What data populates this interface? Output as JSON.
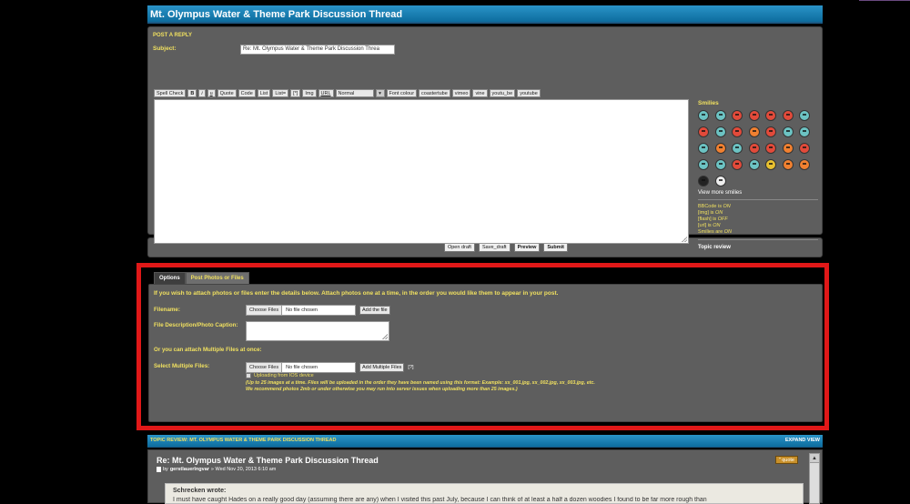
{
  "thread_title": "Mt. Olympus Water & Theme Park Discussion Thread",
  "post_reply": {
    "heading": "POST A REPLY",
    "subject_label": "Subject:",
    "subject_value": "Re: Mt. Olympus Water & Theme Park Discussion Threa"
  },
  "toolbar": {
    "spell_check": "Spell Check",
    "bold": "B",
    "italic": "i",
    "underline": "u",
    "quote": "Quote",
    "code": "Code",
    "list": "List",
    "list_eq": "List=",
    "list_item": "[*]",
    "img": "Img",
    "url": "URL",
    "font_size": "Normal",
    "font_colour": "Font colour",
    "coastertube": "coastertube",
    "vimeo": "vimeo",
    "vine": "vine",
    "youtu_be": "youtu_be",
    "youtube": "youtube"
  },
  "smilies": {
    "title": "Smilies",
    "view_more": "View more smilies",
    "icons": [
      "teal",
      "teal",
      "red",
      "red",
      "red",
      "red",
      "teal",
      "red",
      "teal",
      "red",
      "org",
      "red",
      "teal",
      "teal",
      "teal",
      "org",
      "teal",
      "red",
      "red",
      "org",
      "red",
      "teal",
      "teal",
      "red",
      "teal",
      "yel",
      "org",
      "org",
      "blk",
      "wht"
    ]
  },
  "bbcode": {
    "bbcode_prefix": "BBCode is ",
    "bbcode_state": "ON",
    "img_prefix": "[img] is ",
    "img_state": "ON",
    "flash_prefix": "[flash] is ",
    "flash_state": "OFF",
    "url_prefix": "[url] is ",
    "url_state": "ON",
    "smilies_prefix": "Smilies are ",
    "smilies_state": "ON",
    "topic_review": "Topic review"
  },
  "buttons": {
    "open_draft": "Open draft",
    "save_draft": "Save_draft",
    "preview": "Preview",
    "submit": "Submit"
  },
  "tabs": [
    "Options",
    "Post Photos or Files"
  ],
  "attach": {
    "intro": "If you wish to attach photos or files enter the details below. Attach photos one at a time, in the order you would like them to appear in your post.",
    "filename_label": "Filename:",
    "choose_files": "Choose Files",
    "no_file": "No file chosen",
    "add_file": "Add the file",
    "desc_label": "File Description/Photo Caption:",
    "multi_intro": "Or you can attach Multiple Files at once:",
    "multi_label": "Select Multiple Files:",
    "add_multiple": "Add Multiple Files",
    "help": "[?]",
    "ios": "Uploading from IOS device",
    "note1": "(Up to 25 images at a time. Files will be uploaded in the order they have been named using this format: Example: xx_001.jpg, xx_002.jpg, xx_003.jpg, etc.",
    "note2": "We recommend photos 2mb or under otherwise you may run into server issues when uploading more than 25 images.)"
  },
  "review": {
    "bar_title": "TOPIC REVIEW: MT. OLYMPUS WATER & THEME PARK DISCUSSION THREAD",
    "expand": "EXPAND VIEW",
    "post_title": "Re: Mt. Olympus Water & Theme Park Discussion Thread",
    "by": "by",
    "author": "gerstlauerlngvar",
    "date": "» Wed Nov 20, 2013 6:10 am",
    "quote_btn": "\" quote",
    "quote_author": "Schrecken wrote:",
    "quote_text": "I must have caught Hades on a really good day (assuming there are any) when I visited this past July, because I can think of at least a half a dozen woodies I found to be far more rough than"
  }
}
